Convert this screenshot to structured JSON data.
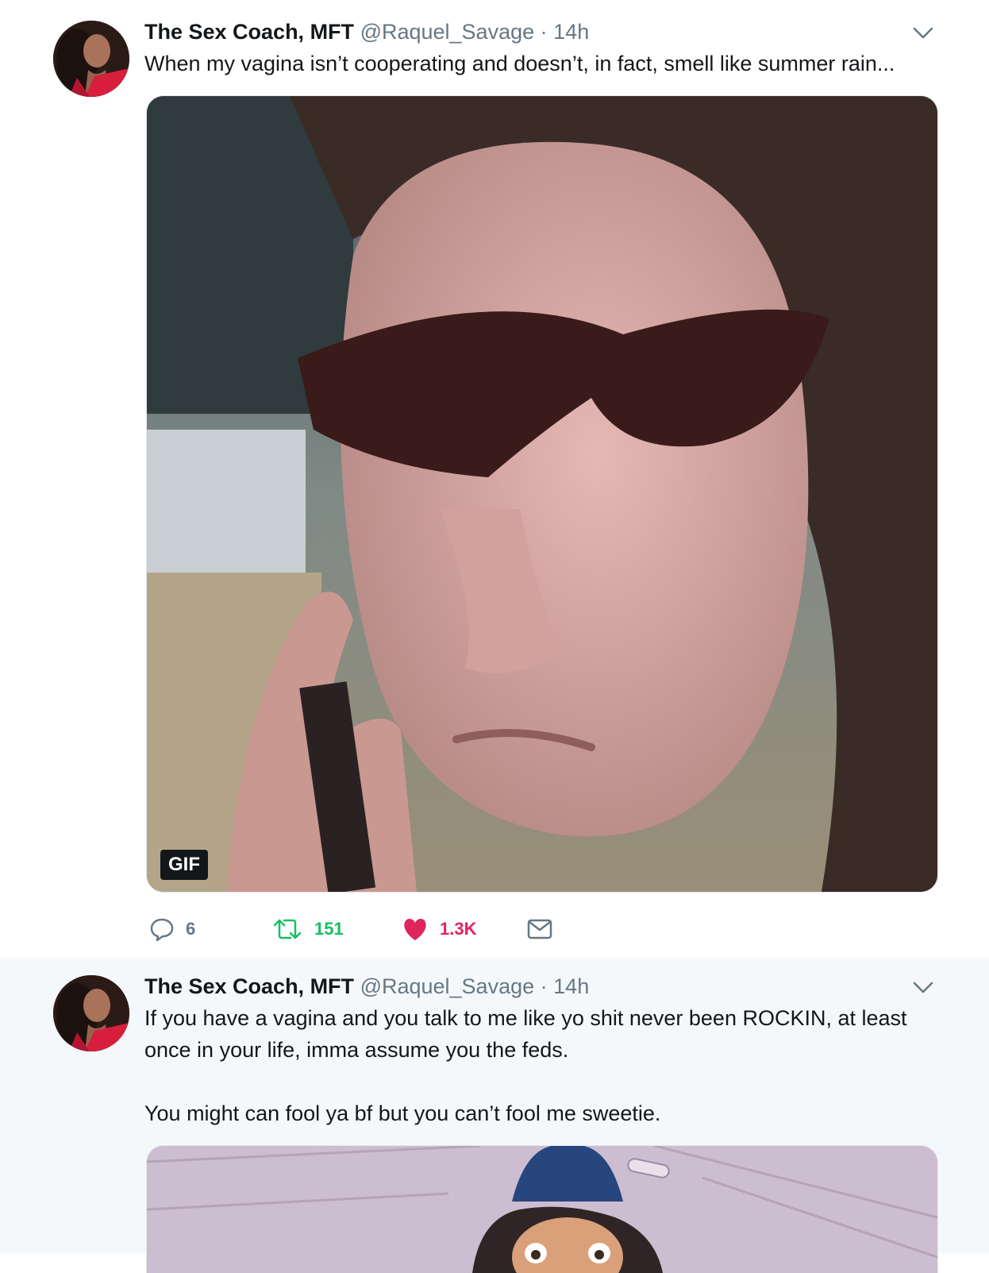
{
  "tweets": [
    {
      "author": {
        "name": "The Sex Coach, MFT",
        "handle": "@Raquel_Savage"
      },
      "separator": "·",
      "time": "14h",
      "text": "When my vagina isn’t cooperating and doesn’t, in fact, smell like summer rain...",
      "media": {
        "type": "gif",
        "badge": "GIF"
      },
      "actions": {
        "replies": "6",
        "retweets": "151",
        "likes": "1.3K"
      }
    },
    {
      "author": {
        "name": "The Sex Coach, MFT",
        "handle": "@Raquel_Savage"
      },
      "separator": "·",
      "time": "14h",
      "text_lines": [
        "If you have a vagina and you talk to me like yo shit never been ROCKIN, at least",
        "once in your life, imma assume you the feds.",
        "You might can fool ya bf but you can’t fool me sweetie."
      ]
    }
  ],
  "colors": {
    "thread_line": "#b3dbf5",
    "reply": "#657786",
    "retweet": "#17bf63",
    "like": "#e0245e",
    "muted": "#657786",
    "second_tweet_bg": "#f5f8fa"
  },
  "icons": [
    "avatar",
    "chevron-down-icon",
    "reply-icon",
    "retweet-icon",
    "heart-icon",
    "direct-message-icon"
  ]
}
